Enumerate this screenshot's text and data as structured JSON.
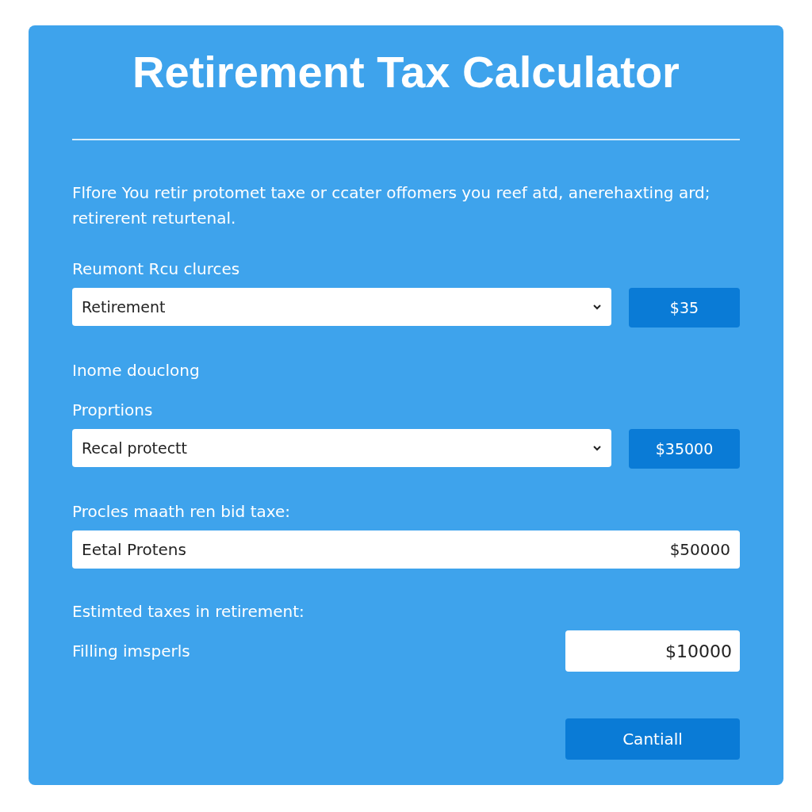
{
  "title": "Retirement Tax Calculator",
  "intro": "Flfore You retir protomet taxe or ccater offomers you reef atd, anerehaxting ard; retirerent returtenal.",
  "fields": [
    {
      "kind": "label",
      "text": "Reumont Rcu clurces"
    },
    {
      "kind": "select",
      "value": "Retirement",
      "amount": "$35"
    },
    {
      "kind": "label",
      "text": "Inome douclong"
    },
    {
      "kind": "label",
      "text": "Proprtions"
    },
    {
      "kind": "select",
      "value": "Recal protectt",
      "amount": "$35000"
    },
    {
      "kind": "label",
      "text": "Procles maath ren bid taxe:"
    },
    {
      "kind": "input",
      "value": "Eetal Protens",
      "amount": "$50000"
    },
    {
      "kind": "label",
      "text": "Estimted taxes in retirement:"
    },
    {
      "kind": "result",
      "text": "Filling imsperls",
      "amount": "$10000"
    }
  ],
  "button": "Cantiall"
}
